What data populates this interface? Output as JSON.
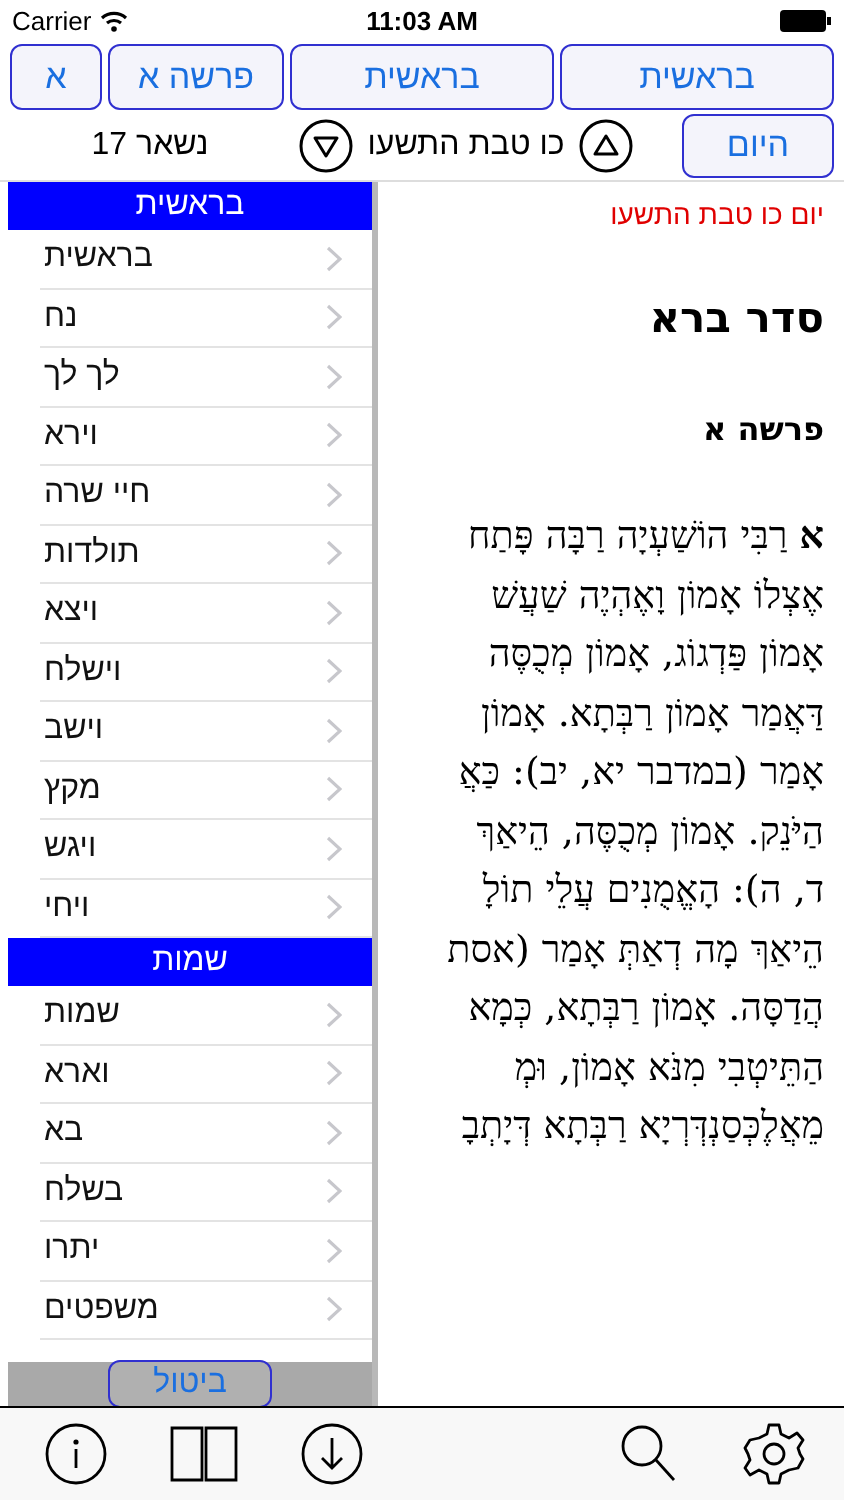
{
  "status_bar": {
    "carrier": "Carrier",
    "time": "11:03 AM"
  },
  "nav_buttons": [
    {
      "label": "בראשית"
    },
    {
      "label": "בראשית"
    },
    {
      "label": "פרשה א"
    },
    {
      "label": "א"
    }
  ],
  "date_bar": {
    "today_button": "היום",
    "date": "כו טבת התשעו",
    "remaining": "נשאר 17"
  },
  "book_list": {
    "sections": [
      {
        "title": "בראשית",
        "items": [
          {
            "label": "בראשית"
          },
          {
            "label": "נח"
          },
          {
            "label": "לך לך"
          },
          {
            "label": "וירא"
          },
          {
            "label": "חיי שרה"
          },
          {
            "label": "תולדות"
          },
          {
            "label": "ויצא"
          },
          {
            "label": "וישלח"
          },
          {
            "label": "וישב"
          },
          {
            "label": "מקץ"
          },
          {
            "label": "ויגש"
          },
          {
            "label": "ויחי"
          }
        ]
      },
      {
        "title": "שמות",
        "items": [
          {
            "label": "שמות"
          },
          {
            "label": "וארא"
          },
          {
            "label": "בא"
          },
          {
            "label": "בשלח"
          },
          {
            "label": "יתרו"
          },
          {
            "label": "משפטים"
          }
        ]
      }
    ],
    "cancel_button": "ביטול"
  },
  "content": {
    "date_line": "יום כו טבת התשעו",
    "title": "סדר ברא",
    "subtitle": "פרשה א",
    "lines": [
      "**א** רַבִּי הוֹשַׁעְיָה רַבָּה פָּתַח",
      "אֶצְלוֹ אָמוֹן וָאֶהְיֶה שַׁעֲשׁ",
      "אָמוֹן פַּדְגוֹג, אָמוֹן מְכֻסֶּה",
      "דַּאֲמַר אָמוֹן רַבְּתָא. אָמוֹן",
      "אָמַר (במדבר יא, יב): כַּאֲ",
      "הַיֹּנֵק. אָמוֹן מְכֻסֶּה, הֵיאַךְ",
      "ד, ה): הָאֱמֻנִים עֲלֵי תוֹלָ",
      "הֵיאַךְ מָה דְאַתְּ אָמַר (אסת",
      "הֲדַסָּה. אָמוֹן רַבְּתָא, כְּמָא",
      "הַתֵּיטְבִי מִנֹּא אָמוֹן, וּמְ",
      "מֵאֲלֶכְּסַנְדְּרְיָא רַבְּתָא דְּיָתְבָ"
    ]
  }
}
